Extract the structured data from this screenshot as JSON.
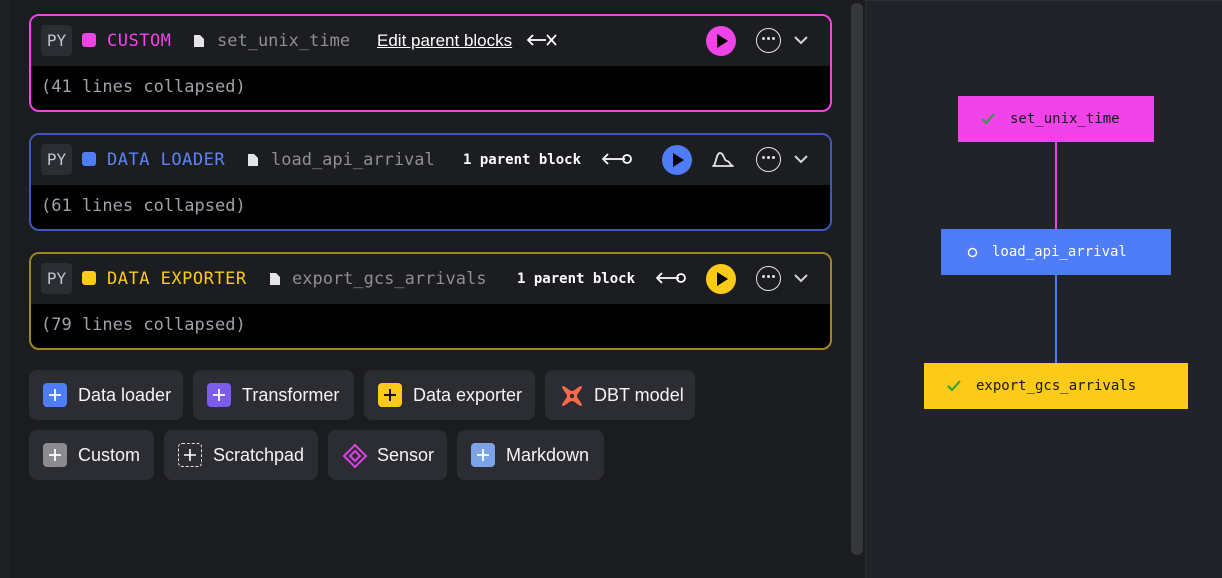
{
  "colors": {
    "custom": "#f043e8",
    "data_loader": "#4f7cf7",
    "data_exporter": "#fcca18",
    "transformer": "#7c5ced",
    "dbt": "#fc6949",
    "markdown": "#7ca3e6",
    "custom_gray": "#8a8a8f"
  },
  "blocks": [
    {
      "language": "PY",
      "type_label": "CUSTOM",
      "file_name": "set_unix_time",
      "parents_label": "Edit parent blocks",
      "body_text": "(41 lines collapsed)",
      "icons": [
        "file-icon",
        "disconnect-icon",
        "play-icon",
        "more-icon",
        "chevron-down-icon"
      ]
    },
    {
      "language": "PY",
      "type_label": "DATA LOADER",
      "file_name": "load_api_arrival",
      "parents_label": "1 parent block",
      "body_text": "(61 lines collapsed)",
      "icons": [
        "file-icon",
        "parent-connection-icon",
        "play-icon",
        "chart-icon",
        "more-icon",
        "chevron-down-icon"
      ]
    },
    {
      "language": "PY",
      "type_label": "DATA EXPORTER",
      "file_name": "export_gcs_arrivals",
      "parents_label": "1 parent block",
      "body_text": "(79 lines collapsed)",
      "icons": [
        "file-icon",
        "parent-connection-icon",
        "play-icon",
        "more-icon",
        "chevron-down-icon"
      ]
    }
  ],
  "add_buttons": [
    {
      "label": "Data loader",
      "icon": "plus-icon"
    },
    {
      "label": "Transformer",
      "icon": "plus-icon"
    },
    {
      "label": "Data exporter",
      "icon": "plus-icon"
    },
    {
      "label": "DBT model",
      "icon": "dbt-icon"
    },
    {
      "label": "Custom",
      "icon": "plus-icon"
    },
    {
      "label": "Scratchpad",
      "icon": "plus-outline-icon"
    },
    {
      "label": "Sensor",
      "icon": "sensor-icon"
    },
    {
      "label": "Markdown",
      "icon": "plus-icon"
    }
  ],
  "dependency_graph": {
    "nodes": [
      {
        "label": "set_unix_time",
        "status_icon": "check-icon"
      },
      {
        "label": "load_api_arrival",
        "status_icon": "circle-icon"
      },
      {
        "label": "export_gcs_arrivals",
        "status_icon": "check-icon"
      }
    ]
  }
}
